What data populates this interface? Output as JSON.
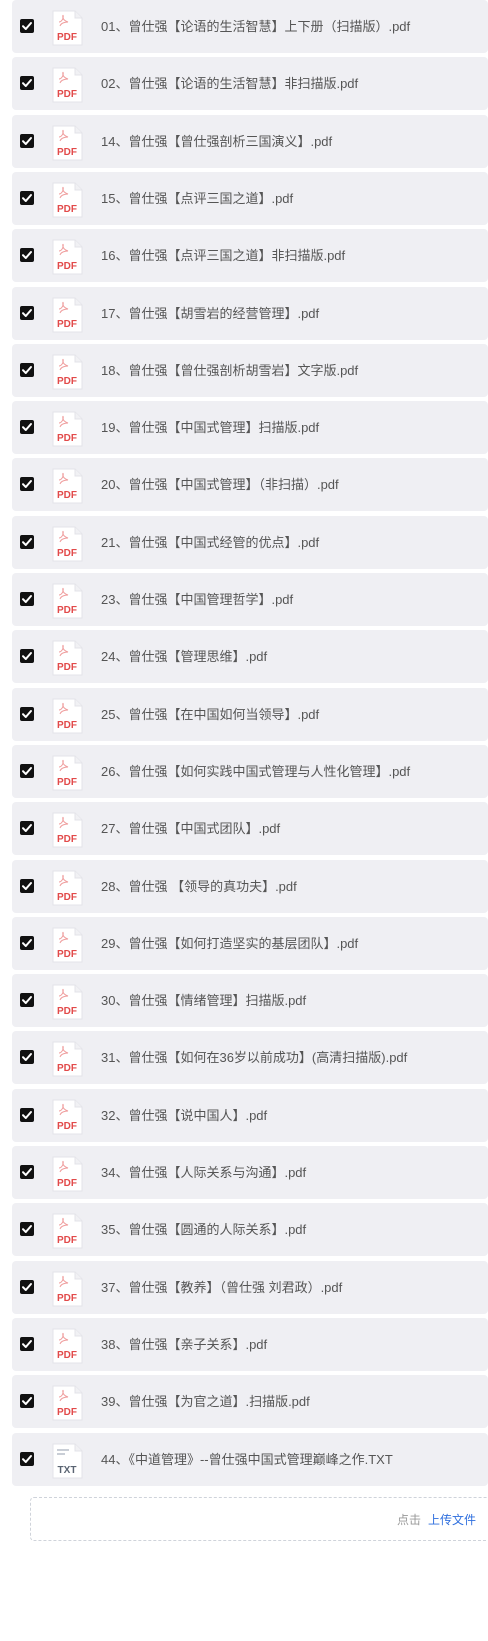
{
  "files": [
    {
      "name": "01、曾仕强【论语的生活智慧】上下册（扫描版）.pdf",
      "type": "PDF",
      "checked": true
    },
    {
      "name": "02、曾仕强【论语的生活智慧】非扫描版.pdf",
      "type": "PDF",
      "checked": true
    },
    {
      "name": "14、曾仕强【曾仕强剖析三国演义】.pdf",
      "type": "PDF",
      "checked": true
    },
    {
      "name": "15、曾仕强【点评三国之道】.pdf",
      "type": "PDF",
      "checked": true
    },
    {
      "name": "16、曾仕强【点评三国之道】非扫描版.pdf",
      "type": "PDF",
      "checked": true
    },
    {
      "name": "17、曾仕强【胡雪岩的经营管理】.pdf",
      "type": "PDF",
      "checked": true
    },
    {
      "name": "18、曾仕强【曾仕强剖析胡雪岩】文字版.pdf",
      "type": "PDF",
      "checked": true
    },
    {
      "name": "19、曾仕强【中国式管理】扫描版.pdf",
      "type": "PDF",
      "checked": true
    },
    {
      "name": "20、曾仕强【中国式管理】（非扫描）.pdf",
      "type": "PDF",
      "checked": true
    },
    {
      "name": "21、曾仕强【中国式经管的优点】.pdf",
      "type": "PDF",
      "checked": true
    },
    {
      "name": "23、曾仕强【中国管理哲学】.pdf",
      "type": "PDF",
      "checked": true
    },
    {
      "name": "24、曾仕强【管理思维】.pdf",
      "type": "PDF",
      "checked": true
    },
    {
      "name": "25、曾仕强【在中国如何当领导】.pdf",
      "type": "PDF",
      "checked": true
    },
    {
      "name": "26、曾仕强【如何实践中国式管理与人性化管理】.pdf",
      "type": "PDF",
      "checked": true
    },
    {
      "name": "27、曾仕强【中国式团队】.pdf",
      "type": "PDF",
      "checked": true
    },
    {
      "name": "28、曾仕强 【领导的真功夫】.pdf",
      "type": "PDF",
      "checked": true
    },
    {
      "name": "29、曾仕强【如何打造坚实的基层团队】.pdf",
      "type": "PDF",
      "checked": true
    },
    {
      "name": "30、曾仕强【情绪管理】扫描版.pdf",
      "type": "PDF",
      "checked": true
    },
    {
      "name": "31、曾仕强【如何在36岁以前成功】(高清扫描版).pdf",
      "type": "PDF",
      "checked": true
    },
    {
      "name": "32、曾仕强【说中国人】.pdf",
      "type": "PDF",
      "checked": true
    },
    {
      "name": "34、曾仕强【人际关系与沟通】.pdf",
      "type": "PDF",
      "checked": true
    },
    {
      "name": "35、曾仕强【圆通的人际关系】.pdf",
      "type": "PDF",
      "checked": true
    },
    {
      "name": "37、曾仕强【教养】（曾仕强 刘君政）.pdf",
      "type": "PDF",
      "checked": true
    },
    {
      "name": "38、曾仕强【亲子关系】.pdf",
      "type": "PDF",
      "checked": true
    },
    {
      "name": "39、曾仕强【为官之道】.扫描版.pdf",
      "type": "PDF",
      "checked": true
    },
    {
      "name": "44、《中道管理》--曾仕强中国式管理巅峰之作.TXT",
      "type": "TXT",
      "checked": true
    }
  ],
  "upload": {
    "hint": "点击",
    "link": "上传文件"
  },
  "colors": {
    "row_bg": "#efeff3",
    "pdf_red": "#e24a4a",
    "txt_gray": "#5a6472",
    "link_blue": "#2f6fde"
  }
}
